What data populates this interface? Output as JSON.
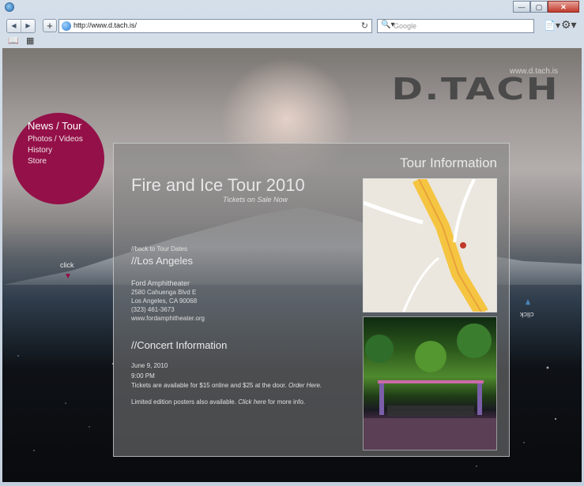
{
  "browser": {
    "address_url": "http://www.d.tach.is/",
    "search_placeholder": "Google"
  },
  "site": {
    "url_small": "www.d.tach.is",
    "logo": "D.TACH",
    "nav": [
      "News / Tour",
      "Photos / Videos",
      "History",
      "Store"
    ],
    "click_left": "click",
    "click_right": "click"
  },
  "panel": {
    "heading": "Tour Information",
    "event_title": "Fire and Ice Tour 2010",
    "tickets_note": "Tickets on Sale Now",
    "back_link": "//back to Tour Dates",
    "city": "//Los Angeles",
    "venue": "Ford Amphitheater",
    "address_lines": [
      "2580 Cahuenga Blvd E",
      "Los Angeles, CA 90068",
      "(323) 461-3673",
      "www.fordamphitheater.org"
    ],
    "concert_heading": "//Concert Information",
    "date": "June 9, 2010",
    "time": "9:00 PM",
    "tickets_text": "Tickets are available for $15 online and $25 at the door.",
    "tickets_link": "Order Here.",
    "posters_text": "Limited edition posters also available.",
    "posters_link": "Click here",
    "posters_after": "for more info."
  },
  "colors": {
    "accent": "#941048",
    "panel_bg": "rgba(128,128,128,0.55)"
  }
}
